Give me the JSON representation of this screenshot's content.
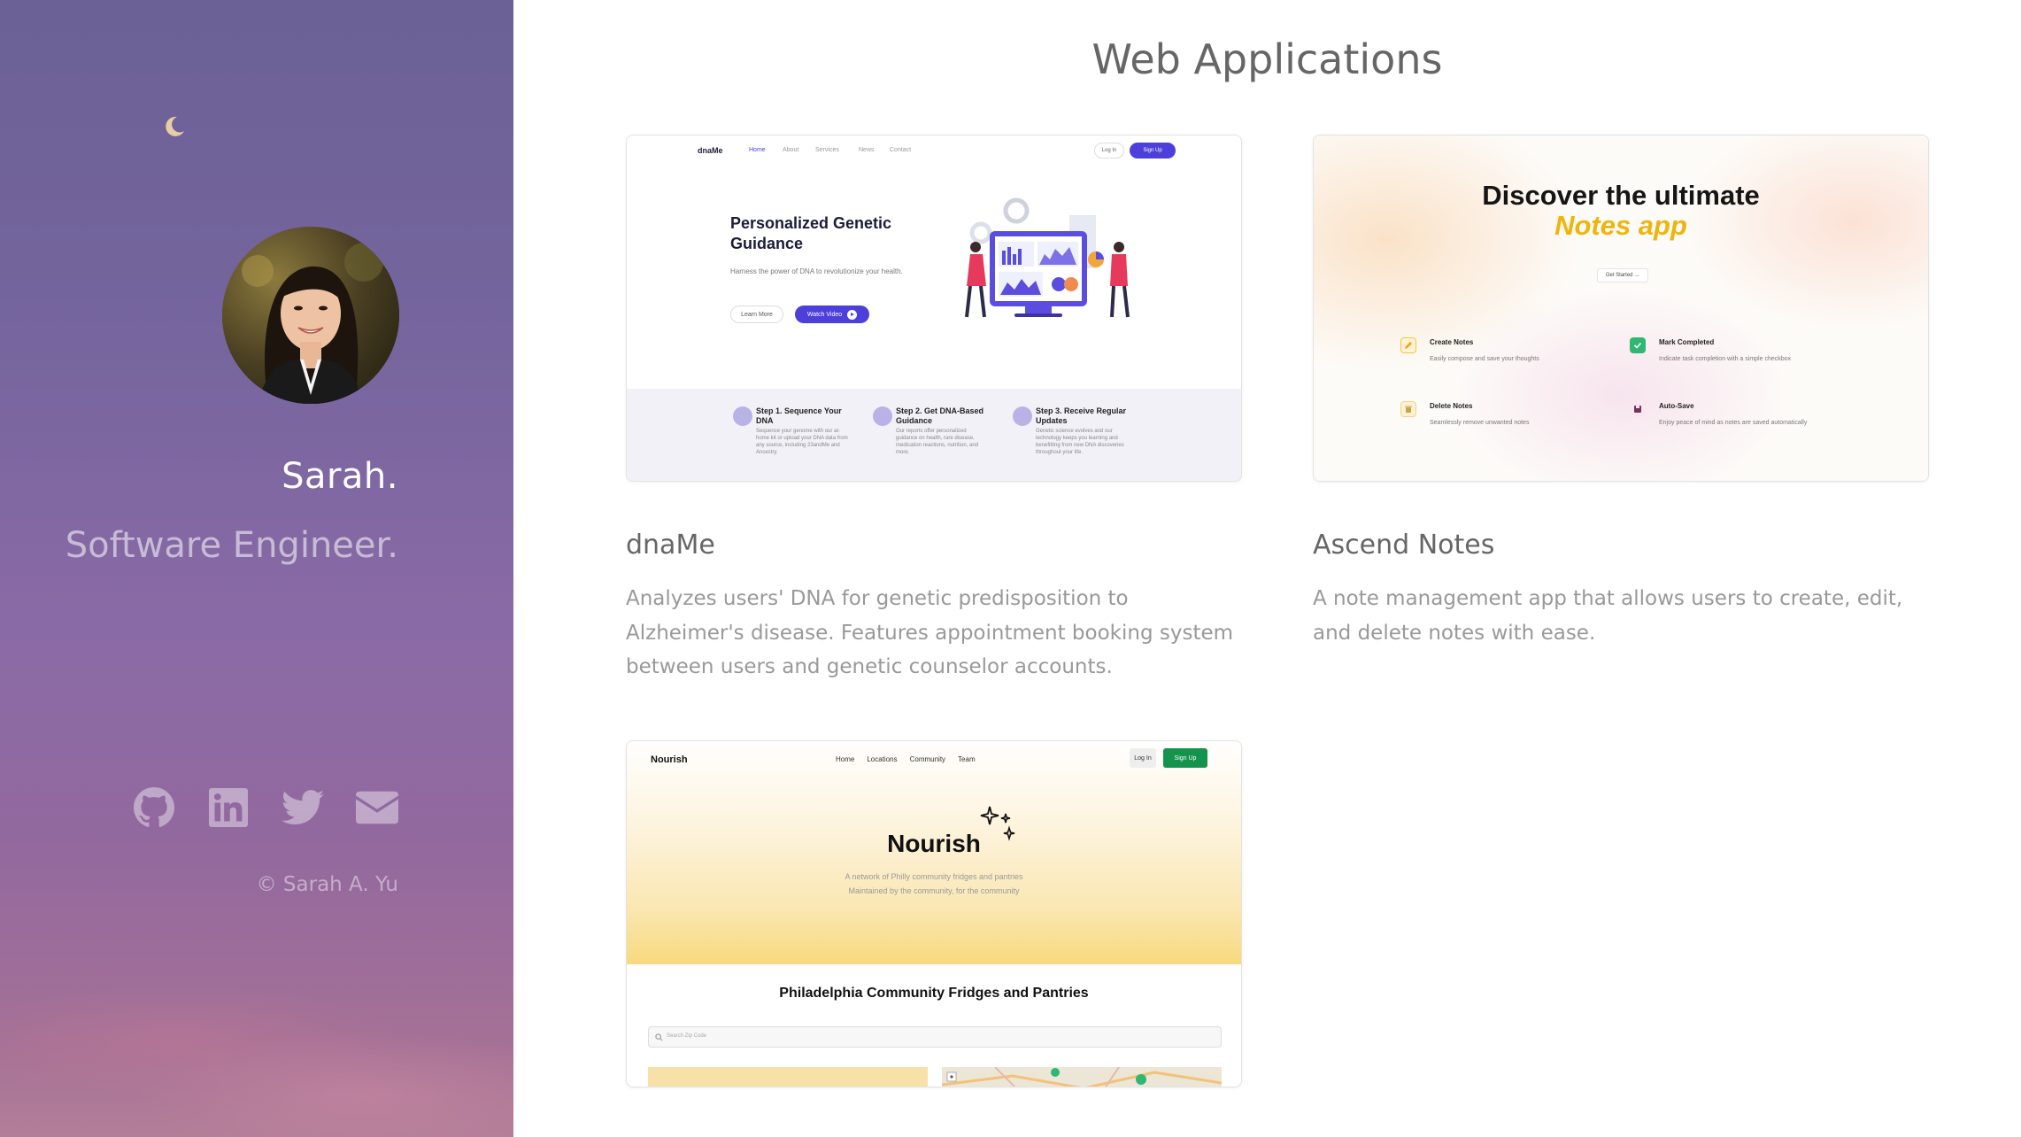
{
  "profile": {
    "name": "Sarah.",
    "role": "Software Engineer.",
    "copyright": "© Sarah A. Yu",
    "social_icons": [
      "github-icon",
      "linkedin-icon",
      "twitter-icon",
      "email-icon"
    ]
  },
  "section": {
    "title": "Web Applications"
  },
  "projects": [
    {
      "title": "dnaMe",
      "description": "Analyzes users' DNA for genetic predisposition to Alzheimer's disease. Features appointment booking system between users and genetic counselor accounts.",
      "shot": {
        "logo": "dnaMe",
        "nav": [
          "Home",
          "About",
          "Services",
          "News",
          "Contact"
        ],
        "login": "Log In",
        "signup": "Sign Up",
        "hero_title": "Personalized Genetic Guidance",
        "hero_sub": "Harness the power of DNA to revolutionize your health.",
        "btn_learn": "Learn More",
        "btn_watch": "Watch Video",
        "steps": [
          {
            "title": "Step 1. Sequence Your DNA",
            "text": "Sequence your genome with our at-home kit or upload your DNA data from any source, including 23andMe and Ancestry."
          },
          {
            "title": "Step 2. Get DNA-Based Guidance",
            "text": "Our reports offer personalized guidance on health, rare disease, medication reactions, nutrition, and more."
          },
          {
            "title": "Step 3. Receive Regular Updates",
            "text": "Genetic science evolves and our technology keeps you learning and benefitting from new DNA discoveries throughout your life."
          }
        ]
      }
    },
    {
      "title": "Ascend Notes",
      "description": "A note management app that allows users to create, edit, and delete notes with ease.",
      "shot": {
        "headline": "Discover the ultimate",
        "headline_accent": "Notes app",
        "cta": "Get Started →",
        "features": [
          {
            "title": "Create Notes",
            "text": "Easily compose and save your thoughts",
            "icon": "pencil-icon",
            "color": "#f6c343"
          },
          {
            "title": "Mark Completed",
            "text": "Indicate task completion with a simple checkbox",
            "icon": "checkbox-icon",
            "color": "#2eb872"
          },
          {
            "title": "Delete Notes",
            "text": "Seamlessly remove unwanted notes",
            "icon": "trash-icon",
            "color": "#f0d58a"
          },
          {
            "title": "Auto-Save",
            "text": "Enjoy peace of mind as notes are saved automatically",
            "icon": "save-icon",
            "color": "#7b2f5b"
          }
        ]
      }
    },
    {
      "title": "Nourish",
      "shot": {
        "logo": "Nourish",
        "nav": [
          "Home",
          "Locations",
          "Community",
          "Team"
        ],
        "login": "Log In",
        "signup": "Sign Up",
        "headline": "Nourish",
        "sub1": "A network of Philly community fridges and pantries",
        "sub2": "Maintained by the community, for the community",
        "section_title": "Philadelphia Community Fridges and Pantries",
        "search_placeholder": "Search Zip Code"
      }
    }
  ],
  "colors": {
    "dna_accent": "#4d3fd9",
    "ascend_accent": "#f0b40c",
    "nourish_accent": "#14934d"
  }
}
